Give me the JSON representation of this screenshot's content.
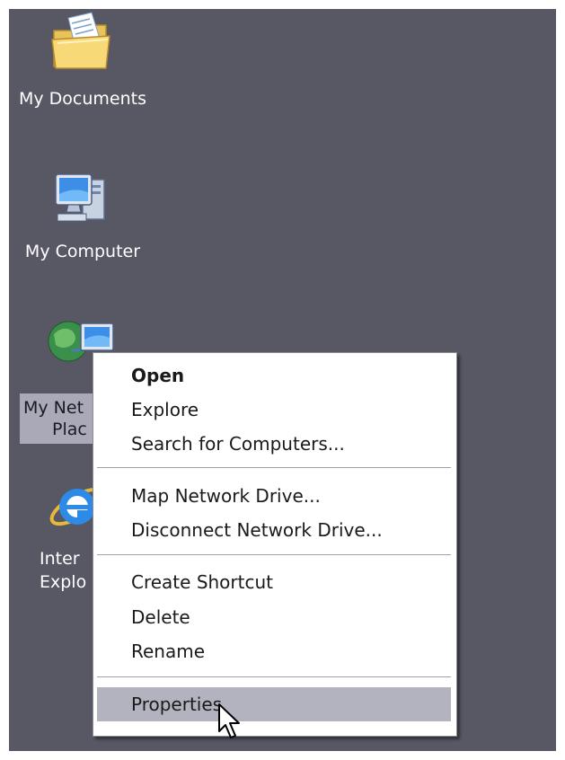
{
  "desktop": {
    "background_color": "#585764",
    "icons": [
      {
        "label": "My Documents",
        "icon": "folder-documents-icon"
      },
      {
        "label": "My Computer",
        "icon": "computer-icon"
      },
      {
        "label_line1": "My Net",
        "label_line2": "Plac",
        "icon": "network-places-icon",
        "selected": true
      },
      {
        "label_line1": "Inter",
        "label_line2": "Explo",
        "icon": "internet-explorer-icon"
      }
    ]
  },
  "context_menu": {
    "items": [
      {
        "label": "Open",
        "bold": true
      },
      {
        "label": "Explore"
      },
      {
        "label": "Search for Computers..."
      },
      {
        "label": "Map Network Drive..."
      },
      {
        "label": "Disconnect Network Drive..."
      },
      {
        "label": "Create Shortcut"
      },
      {
        "label": "Delete"
      },
      {
        "label": "Rename"
      },
      {
        "label": "Properties",
        "highlighted": true
      }
    ],
    "highlight_color": "#b3b3c0"
  },
  "cursor": {
    "icon": "arrow-cursor-icon"
  }
}
